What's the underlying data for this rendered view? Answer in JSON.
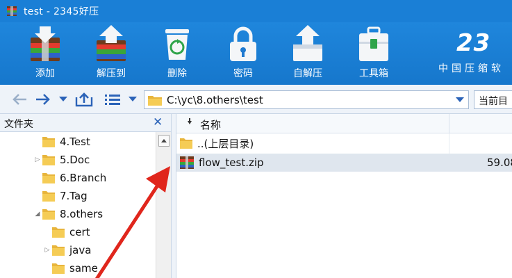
{
  "window": {
    "title": "test - 2345好压"
  },
  "toolbar": {
    "items": [
      {
        "label": "添加",
        "icon": "add-archive-icon"
      },
      {
        "label": "解压到",
        "icon": "extract-to-icon"
      },
      {
        "label": "删除",
        "icon": "recycle-bin-icon"
      },
      {
        "label": "密码",
        "icon": "lock-icon"
      },
      {
        "label": "自解压",
        "icon": "self-extract-icon"
      },
      {
        "label": "工具箱",
        "icon": "toolbox-icon"
      }
    ],
    "brand_number": "23",
    "brand_sub": "中国压缩软"
  },
  "nav": {
    "address": "C:\\yc\\8.others\\test",
    "current_dir_label": "当前目"
  },
  "left_panel": {
    "title": "文件夹",
    "tree": [
      {
        "label": "4.Test",
        "expander": ""
      },
      {
        "label": "5.Doc",
        "expander": "▷"
      },
      {
        "label": "6.Branch",
        "expander": ""
      },
      {
        "label": "7.Tag",
        "expander": ""
      },
      {
        "label": "8.others",
        "expander": "◢"
      },
      {
        "label": "cert",
        "expander": ""
      },
      {
        "label": "java",
        "expander": "▷"
      },
      {
        "label": "same",
        "expander": ""
      }
    ]
  },
  "file_list": {
    "columns": {
      "name": "名称"
    },
    "rows": [
      {
        "name": "..(上层目录)",
        "size": ""
      },
      {
        "name": "flow_test.zip",
        "size": "59.08"
      }
    ]
  },
  "colors": {
    "toolbar_blue": "#1a7fd6",
    "annotation_red": "#e0261c",
    "selection": "#dfe6ee"
  }
}
